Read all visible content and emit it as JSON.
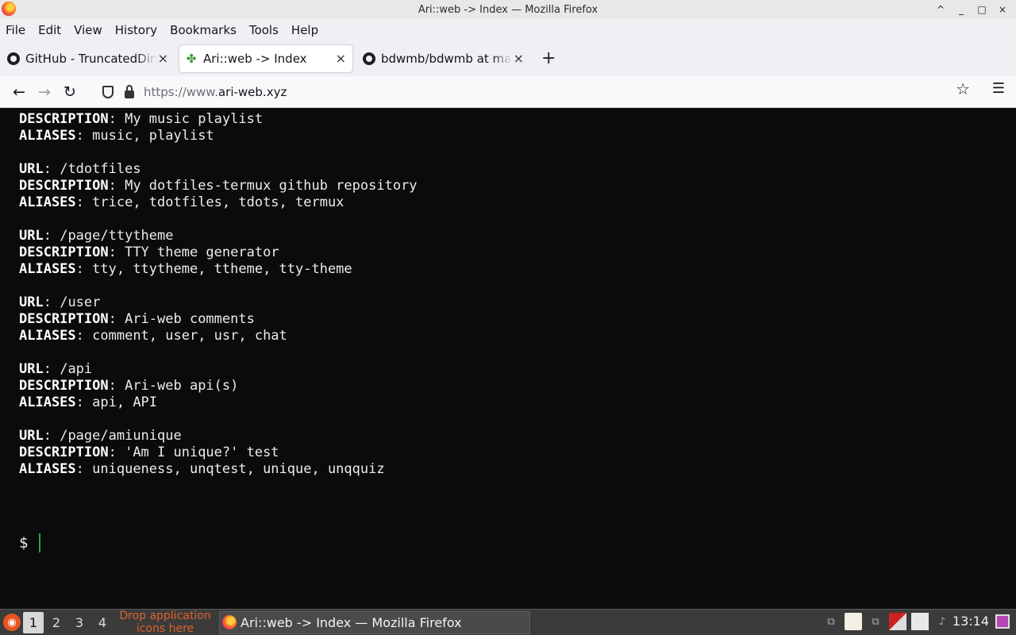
{
  "window": {
    "title": "Ari::web -> Index — Mozilla Firefox",
    "controls": [
      "^",
      "_",
      "□",
      "×"
    ]
  },
  "menubar": {
    "items": [
      "File",
      "Edit",
      "View",
      "History",
      "Bookmarks",
      "Tools",
      "Help"
    ]
  },
  "tabs": [
    {
      "label": "GitHub - TruncatedDinosour/",
      "icon": "github-icon",
      "active": false
    },
    {
      "label": "Ari::web -> Index",
      "icon": "leaf-icon",
      "active": true
    },
    {
      "label": "bdwmb/bdwmb at main",
      "icon": "github-icon",
      "active": false
    }
  ],
  "new_tab_label": "+",
  "navbar": {
    "url_prefix": "https://www.",
    "url_host": "ari-web.xyz"
  },
  "terminal": {
    "partial_line": "        /",
    "entries": [
      {
        "url": null,
        "description": "My music playlist",
        "aliases": "music, playlist"
      },
      {
        "url": "/tdotfiles",
        "description": "My dotfiles-termux github repository",
        "aliases": "trice, tdotfiles, tdots, termux"
      },
      {
        "url": "/page/ttytheme",
        "description": "TTY theme generator",
        "aliases": "tty, ttytheme, ttheme, tty-theme"
      },
      {
        "url": "/user",
        "description": "Ari-web comments",
        "aliases": "comment, user, usr, chat"
      },
      {
        "url": "/api",
        "description": "Ari-web api(s)",
        "aliases": "api, API"
      },
      {
        "url": "/page/amiunique",
        "description": "'Am I unique?' test",
        "aliases": "uniqueness, unqtest, unique, unqquiz"
      }
    ],
    "keys": {
      "url": "URL",
      "description": "DESCRIPTION",
      "aliases": "ALIASES"
    },
    "prompt": "$"
  },
  "taskbar": {
    "workspaces": [
      "1",
      "2",
      "3",
      "4"
    ],
    "active_workspace": "1",
    "drop_hint": "Drop application icons here",
    "task_label": "Ari::web -> Index — Mozilla Firefox",
    "clock": "13:14"
  },
  "colors": {
    "terminal_bg": "#0b0b0b",
    "cursor": "#2fa83a",
    "drop_hint": "#e0602a"
  }
}
